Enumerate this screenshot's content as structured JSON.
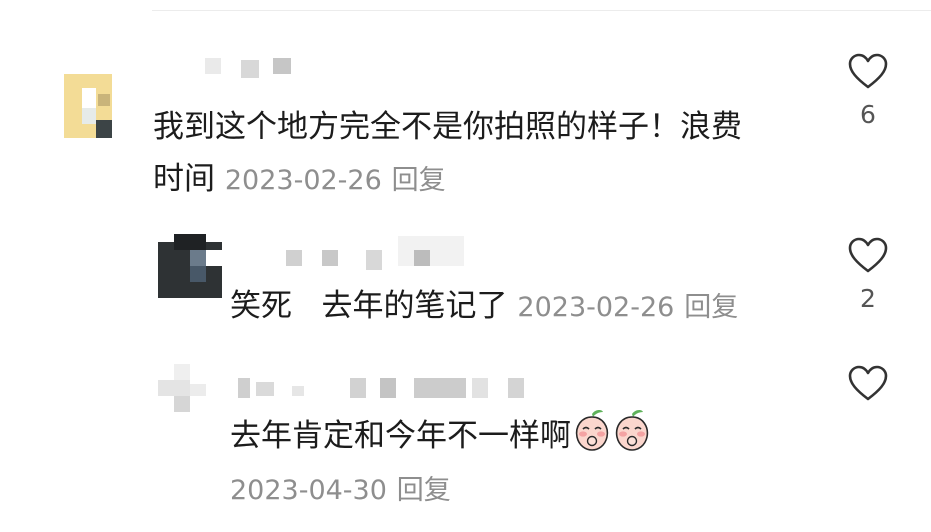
{
  "comments": [
    {
      "text_line1": "我到这个地方完全不是你拍照的样子！浪费",
      "text_line2": "时间",
      "date": "2023-02-26",
      "reply_label": "回复",
      "likes": "6"
    },
    {
      "text": "笑死   去年的笔记了",
      "date": "2023-02-26",
      "reply_label": "回复",
      "likes": "2"
    },
    {
      "text": "去年肯定和今年不一样啊",
      "emojis": [
        "peach-sneaky-emoji",
        "peach-sneaky-emoji"
      ],
      "date": "2023-04-30",
      "reply_label": "回复",
      "likes": ""
    }
  ],
  "icons": {
    "like": "heart-outline-icon"
  },
  "colors": {
    "text": "#1c1c1c",
    "meta": "#8e8e8e",
    "heart_stroke": "#333333"
  }
}
